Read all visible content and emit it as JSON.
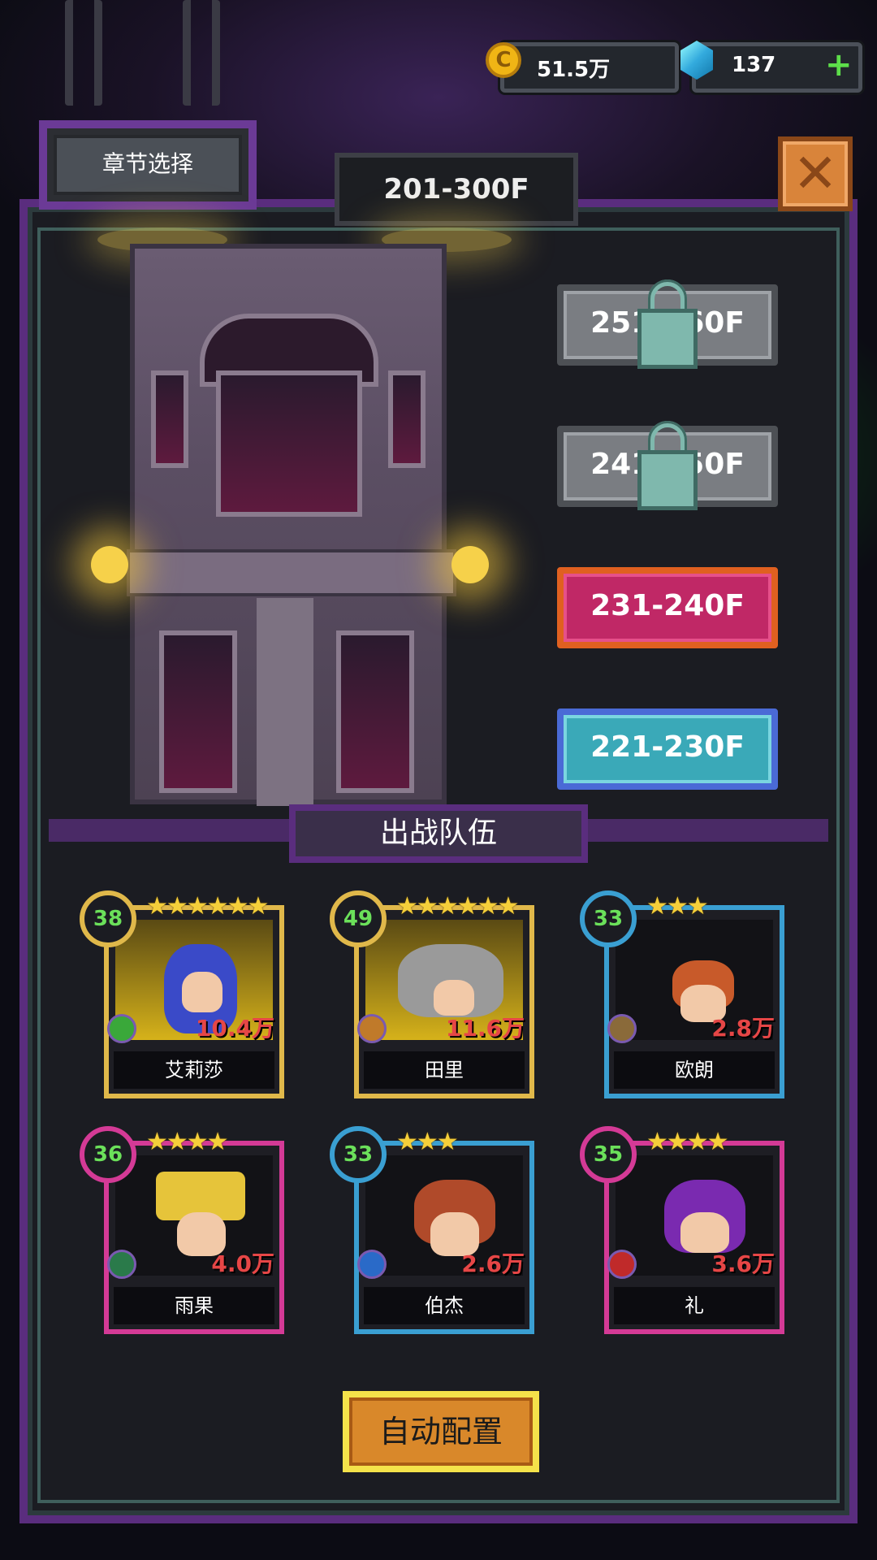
{
  "resources": {
    "gold": {
      "icon": "gold-coin-icon",
      "value": "51.5万"
    },
    "gems": {
      "icon": "diamond-icon",
      "value": "137"
    }
  },
  "header": {
    "chapter_button": "章节选择",
    "floor_range": "201-300F"
  },
  "floor_list": [
    {
      "label": "251-260F",
      "locked": true
    },
    {
      "label": "241-250F",
      "locked": true
    },
    {
      "label": "231-240F",
      "locked": false,
      "color": "#c02866"
    },
    {
      "label": "221-230F",
      "locked": false,
      "color": "#3aa9b8"
    }
  ],
  "team": {
    "title": "出战队伍",
    "heroes": [
      {
        "name": "艾莉莎",
        "level": "38",
        "stars": "★★★★★★",
        "power": "10.4万",
        "rarity": "gold"
      },
      {
        "name": "田里",
        "level": "49",
        "stars": "★★★★★★",
        "power": "11.6万",
        "rarity": "gold"
      },
      {
        "name": "欧朗",
        "level": "33",
        "stars": "★★★",
        "power": "2.8万",
        "rarity": "cyan"
      },
      {
        "name": "雨果",
        "level": "36",
        "stars": "★★★★",
        "power": "4.0万",
        "rarity": "pink"
      },
      {
        "name": "伯杰",
        "level": "33",
        "stars": "★★★",
        "power": "2.6万",
        "rarity": "cyan"
      },
      {
        "name": "礼",
        "level": "35",
        "stars": "★★★★",
        "power": "3.6万",
        "rarity": "pink"
      }
    ]
  },
  "auto_button": "自动配置",
  "colors": {
    "frame_purple": "#5a2d7e",
    "gold_rarity": "#e0b84a",
    "cyan_rarity": "#3a9fd2",
    "pink_rarity": "#d43a96",
    "power_red": "#e64646",
    "level_green": "#6be05a"
  }
}
